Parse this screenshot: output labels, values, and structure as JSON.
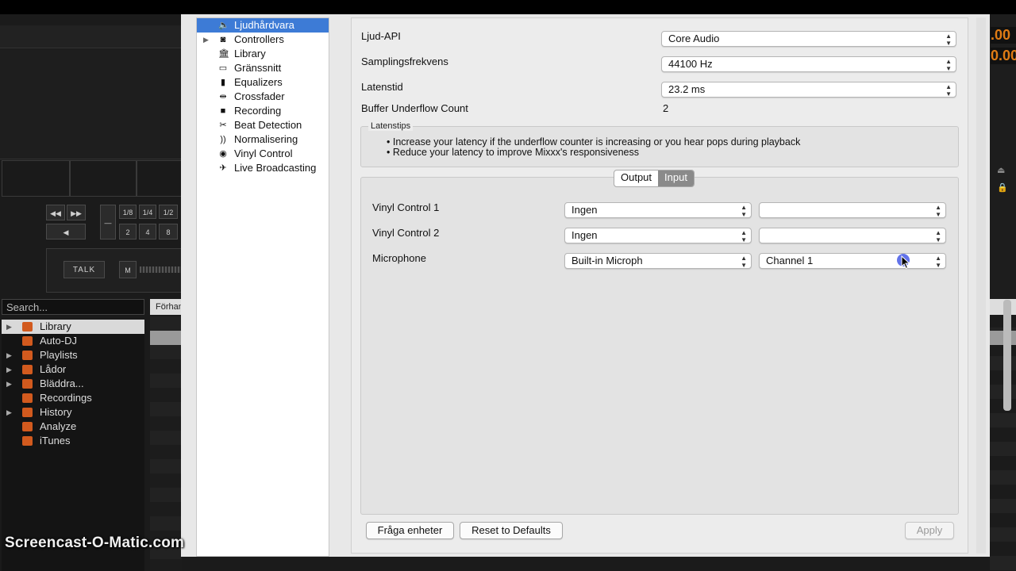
{
  "colors": {
    "accent": "#3d7bd6",
    "library_icon": "#d25a1e",
    "time_orange": "#e07c14"
  },
  "background_app": {
    "deck_buttons": {
      "rew": "◀◀",
      "ff": "▶▶",
      "play": "◀",
      "minus": "—",
      "loop_top": [
        "1/8",
        "1/4",
        "1/2"
      ],
      "loop_bottom": [
        "2",
        "4",
        "8"
      ]
    },
    "talk_label": "TALK",
    "mic_label": "M",
    "search_placeholder": "Search...",
    "track_header": "Förhan",
    "right_time_1": ".00",
    "right_time_2": "0.00",
    "library_tree": [
      {
        "label": "Library",
        "expandable": true,
        "selected": true
      },
      {
        "label": "Auto-DJ",
        "expandable": false,
        "selected": false
      },
      {
        "label": "Playlists",
        "expandable": true,
        "selected": false
      },
      {
        "label": "Lådor",
        "expandable": true,
        "selected": false
      },
      {
        "label": "Bläddra...",
        "expandable": true,
        "selected": false
      },
      {
        "label": "Recordings",
        "expandable": false,
        "selected": false
      },
      {
        "label": "History",
        "expandable": true,
        "selected": false
      },
      {
        "label": "Analyze",
        "expandable": false,
        "selected": false
      },
      {
        "label": "iTunes",
        "expandable": false,
        "selected": false
      }
    ]
  },
  "watermark": "Screencast-O-Matic.com",
  "prefs_nav": [
    {
      "label": "Ljudhårdvara",
      "icon": "speaker-icon",
      "glyph": "🔈",
      "selected": true,
      "expandable": false
    },
    {
      "label": "Controllers",
      "icon": "controller-icon",
      "glyph": "◙",
      "selected": false,
      "expandable": true
    },
    {
      "label": "Library",
      "icon": "library-icon",
      "glyph": "🏛",
      "selected": false,
      "expandable": false
    },
    {
      "label": "Gränssnitt",
      "icon": "monitor-icon",
      "glyph": "▭",
      "selected": false,
      "expandable": false
    },
    {
      "label": "Equalizers",
      "icon": "equalizer-icon",
      "glyph": "▮",
      "selected": false,
      "expandable": false
    },
    {
      "label": "Crossfader",
      "icon": "crossfader-icon",
      "glyph": "⇹",
      "selected": false,
      "expandable": false
    },
    {
      "label": "Recording",
      "icon": "recording-icon",
      "glyph": "■",
      "selected": false,
      "expandable": false
    },
    {
      "label": "Beat Detection",
      "icon": "beat-detection-icon",
      "glyph": "✂",
      "selected": false,
      "expandable": false
    },
    {
      "label": "Normalisering",
      "icon": "normalize-icon",
      "glyph": "))",
      "selected": false,
      "expandable": false
    },
    {
      "label": "Vinyl Control",
      "icon": "vinyl-icon",
      "glyph": "◉",
      "selected": false,
      "expandable": false
    },
    {
      "label": "Live Broadcasting",
      "icon": "broadcast-icon",
      "glyph": "✈",
      "selected": false,
      "expandable": false
    }
  ],
  "sound": {
    "api_label": "Ljud-API",
    "api_value": "Core Audio",
    "rate_label": "Samplingsfrekvens",
    "rate_value": "44100 Hz",
    "latency_label": "Latenstid",
    "latency_value": "23.2 ms",
    "underflow_label": "Buffer Underflow Count",
    "underflow_value": "2"
  },
  "tips": {
    "title": "Latenstips",
    "line1": "• Increase your latency if the underflow counter is increasing or you hear pops during playback",
    "line2": "• Reduce your latency to improve Mixxx's responsiveness"
  },
  "tabs": {
    "output": "Output",
    "input": "Input",
    "active": "input"
  },
  "inputs": [
    {
      "label": "Vinyl Control 1",
      "device": "Ingen",
      "channel": ""
    },
    {
      "label": "Vinyl Control 2",
      "device": "Ingen",
      "channel": ""
    },
    {
      "label": "Microphone",
      "device": "Built-in Microph",
      "channel": "Channel 1"
    }
  ],
  "buttons": {
    "query": "Fråga enheter",
    "reset": "Reset to Defaults",
    "apply": "Apply"
  }
}
